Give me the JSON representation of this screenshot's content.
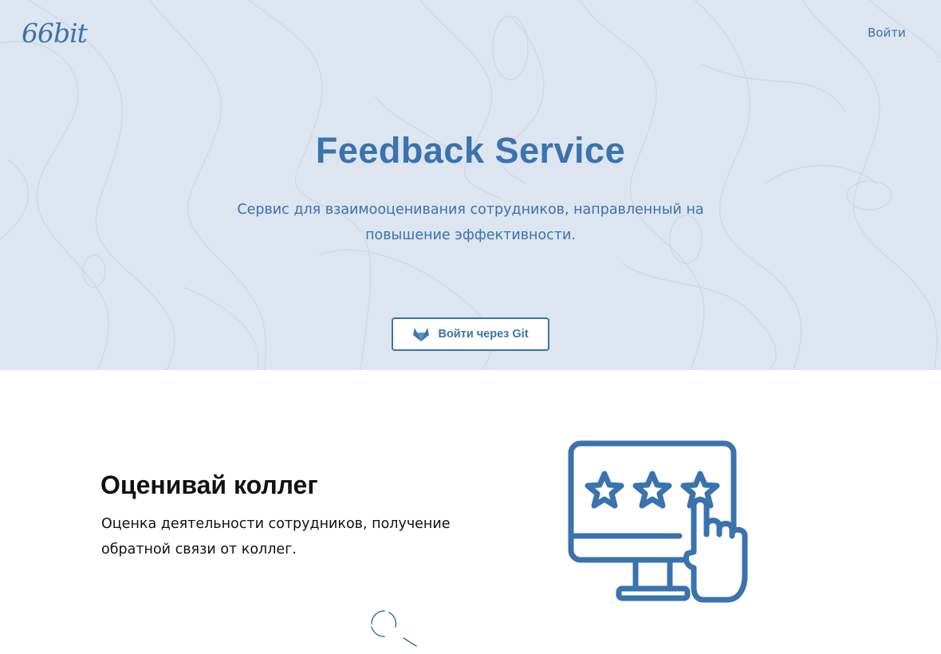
{
  "header": {
    "logo_text": "66bit",
    "login_label": "Войти"
  },
  "hero": {
    "title": "Feedback Service",
    "subtitle": "Сервис для взаимооценивания сотрудников, направленный на повышение эффективности.",
    "git_button_label": "Войти через Git",
    "git_icon": "gitlab-icon"
  },
  "feature": {
    "title": "Оценивай коллег",
    "description": "Оценка деятельности сотрудников, получение обратной связи от коллег.",
    "illustration_icon": "monitor-rating-stars-hand-icon"
  },
  "loading": {
    "icon": "spinner-icon"
  },
  "colors": {
    "accent": "#3a73ad",
    "hero_background": "#dde5f0",
    "page_background": "#ffffff",
    "text": "#111111"
  }
}
